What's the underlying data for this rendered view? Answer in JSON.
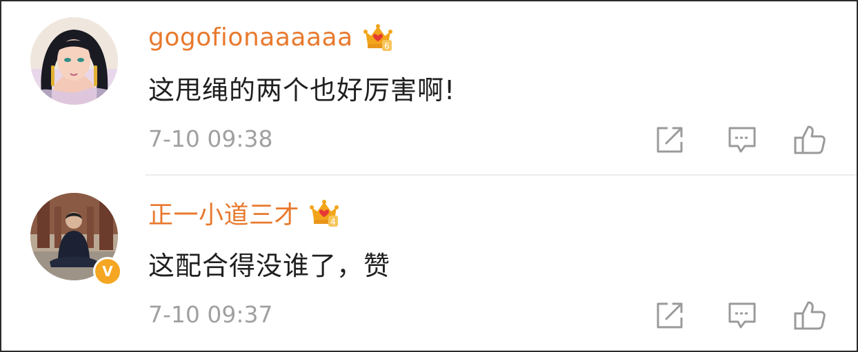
{
  "comments": [
    {
      "username": "gogofionaaaaaa",
      "vip_level": "6",
      "text": "这甩绳的两个也好厉害啊!",
      "time": "7-10 09:38",
      "verified": false
    },
    {
      "username": "正一小道三才",
      "vip_level": "4",
      "text": "这配合得没谁了，赞",
      "time": "7-10 09:37",
      "verified": true,
      "verified_mark": "V"
    }
  ],
  "icons": {
    "share": "share-icon",
    "reply": "comment-icon",
    "like": "thumbs-up-icon",
    "crown": "vip-crown-icon"
  },
  "colors": {
    "username": "#e8792d",
    "text": "#1f1f1f",
    "time": "#a0a0a0",
    "icon": "#9a9a9a",
    "crown": "#f2a51a",
    "verified": "#f5a623"
  }
}
